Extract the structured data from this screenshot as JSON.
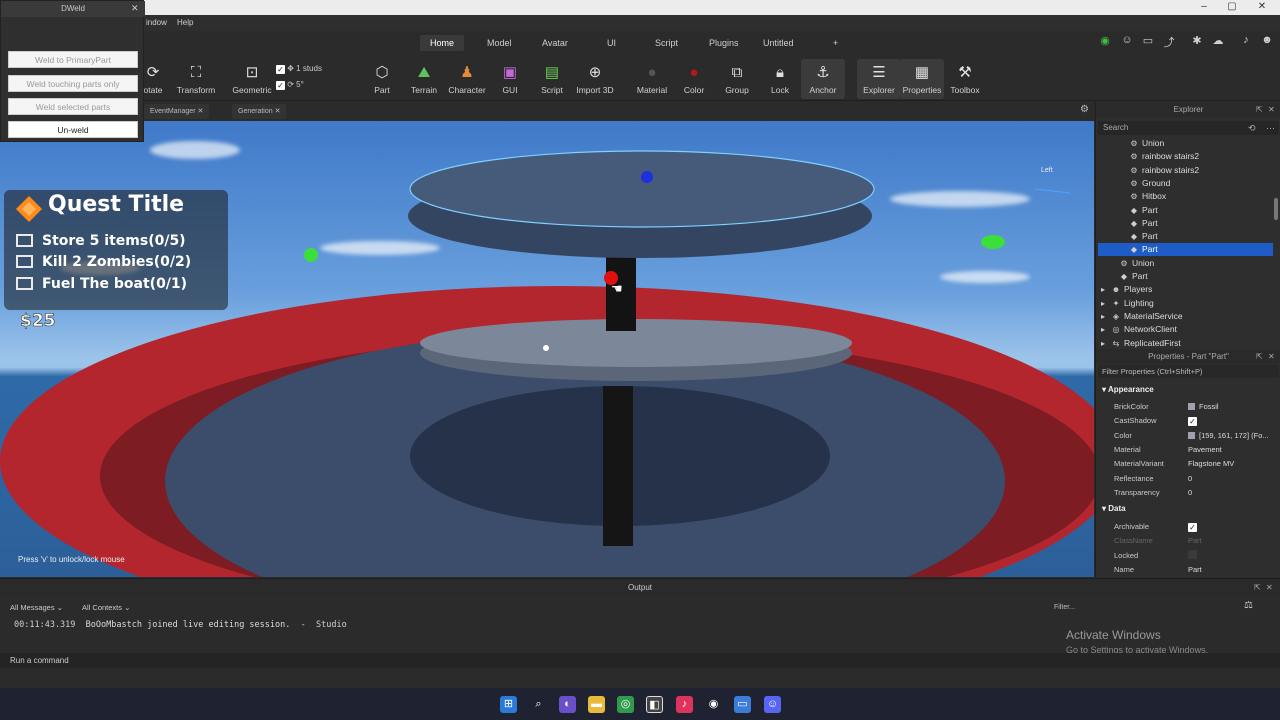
{
  "weld_panel": {
    "title": "DWeld",
    "buttons": [
      "Weld to PrimaryPart",
      "Weld touching parts only",
      "Weld selected parts",
      "Un-weld"
    ]
  },
  "menubar": {
    "items": [
      "indow",
      "Help"
    ]
  },
  "tabs": {
    "home": "Home",
    "model": "Model",
    "avatar": "Avatar",
    "ui": "UI",
    "script": "Script",
    "plugins": "Plugins",
    "untitled": "Untitled"
  },
  "ribbon": {
    "rotate": "otate",
    "transform": "Transform",
    "geometric": "Geometric",
    "move_snap": "1 studs",
    "rotate_snap": "5°",
    "part": "Part",
    "terrain": "Terrain",
    "character": "Character",
    "gui": "GUI",
    "script": "Script",
    "import3d": "Import 3D",
    "material": "Material",
    "color": "Color",
    "group": "Group",
    "lock": "Lock",
    "anchor": "Anchor",
    "explorer": "Explorer",
    "properties": "Properties",
    "toolbox": "Toolbox"
  },
  "doc_tabs": [
    "EventManager",
    "Generation"
  ],
  "viewport": {
    "view_cube_label": "Left",
    "quest": {
      "title": "Quest Title",
      "items": [
        "Store 5 items(0/5)",
        "Kill 2 Zombies(0/2)",
        "Fuel The boat(0/1)"
      ]
    },
    "money": "$25",
    "hint": "Press 'v' to unlock/lock mouse"
  },
  "explorer": {
    "title": "Explorer",
    "search_placeholder": "Search",
    "items": [
      {
        "name": "Union",
        "indent": 2,
        "icon": "union-icon"
      },
      {
        "name": "rainbow stairs2",
        "indent": 2,
        "icon": "model-icon"
      },
      {
        "name": "rainbow stairs2",
        "indent": 2,
        "icon": "model-icon"
      },
      {
        "name": "Ground",
        "indent": 2,
        "icon": "model-icon"
      },
      {
        "name": "Hitbox",
        "indent": 2,
        "icon": "model-icon"
      },
      {
        "name": "Part",
        "indent": 2,
        "icon": "part-icon"
      },
      {
        "name": "Part",
        "indent": 2,
        "icon": "part-icon"
      },
      {
        "name": "Part",
        "indent": 2,
        "icon": "part-icon"
      },
      {
        "name": "Part",
        "indent": 2,
        "icon": "part-icon",
        "selected": true
      },
      {
        "name": "Union",
        "indent": 1,
        "icon": "union-icon"
      },
      {
        "name": "Part",
        "indent": 1,
        "icon": "part-icon"
      },
      {
        "name": "Players",
        "indent": 0,
        "icon": "players-icon"
      },
      {
        "name": "Lighting",
        "indent": 0,
        "icon": "lighting-icon"
      },
      {
        "name": "MaterialService",
        "indent": 0,
        "icon": "material-service-icon"
      },
      {
        "name": "NetworkClient",
        "indent": 0,
        "icon": "network-icon"
      },
      {
        "name": "ReplicatedFirst",
        "indent": 0,
        "icon": "replicated-icon"
      }
    ]
  },
  "properties": {
    "title": "Properties - Part \"Part\"",
    "filter_placeholder": "Filter Properties (Ctrl+Shift+P)",
    "sections": {
      "appearance": "Appearance",
      "data": "Data"
    },
    "appearance_rows": [
      {
        "key": "BrickColor",
        "value": "Fossil",
        "swatch": "#9fa1ac"
      },
      {
        "key": "CastShadow",
        "value": "",
        "check": true
      },
      {
        "key": "Color",
        "value": "[159, 161, 172] (Fo...",
        "swatch": "#9fa1ac"
      },
      {
        "key": "Material",
        "value": "Pavement"
      },
      {
        "key": "MaterialVariant",
        "value": "Flagstone MV"
      },
      {
        "key": "Reflectance",
        "value": "0"
      },
      {
        "key": "Transparency",
        "value": "0"
      }
    ],
    "data_rows": [
      {
        "key": "Archivable",
        "value": "",
        "check": true
      },
      {
        "key": "ClassName",
        "value": "Part",
        "dim": true
      },
      {
        "key": "Locked",
        "value": "",
        "check": false
      },
      {
        "key": "Name",
        "value": "Part"
      }
    ]
  },
  "output": {
    "title": "Output",
    "filter1": "All Messages",
    "filter2": "All Contexts",
    "filter_placeholder": "Filter...",
    "log_time": "00:11:43.319",
    "log_message": "BoOoMbastch joined live editing session.",
    "log_sep": "-",
    "log_source": "Studio",
    "command_placeholder": "Run a command",
    "activate_title": "Activate Windows",
    "activate_sub": "Go to Settings to activate Windows."
  },
  "colors": {
    "selection": "#1e5cc7",
    "stone": "#3b4d6b",
    "red_ring": "#b3262e"
  }
}
